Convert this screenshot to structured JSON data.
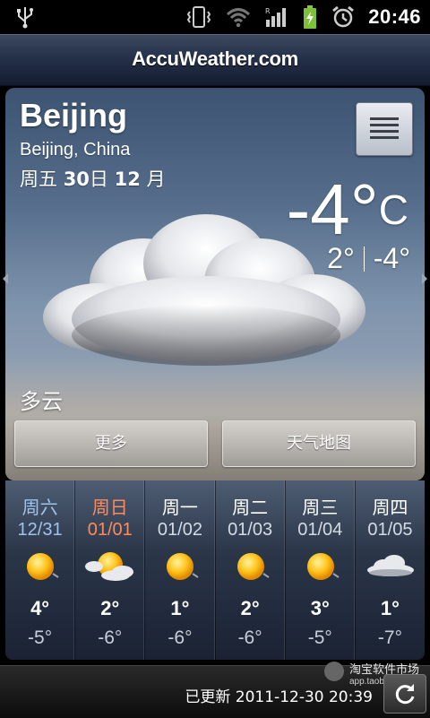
{
  "status_bar": {
    "time": "20:46"
  },
  "header": {
    "brand": "AccuWeather.com"
  },
  "location": {
    "city": "Beijing",
    "region": "Beijing, China"
  },
  "date": {
    "weekday": "周五",
    "day": "30",
    "day_suffix": "日",
    "month": "12",
    "month_suffix": "月"
  },
  "current": {
    "temp": "-4°",
    "unit": "C",
    "high": "2°",
    "low": "-4°",
    "condition": "多云"
  },
  "buttons": {
    "more": "更多",
    "map": "天气地图"
  },
  "forecast": [
    {
      "day": "周六",
      "date": "12/31",
      "high": "4°",
      "low": "-5°",
      "icon": "sunny-icon",
      "color": "#9fc3ee"
    },
    {
      "day": "周日",
      "date": "01/01",
      "high": "2°",
      "low": "-6°",
      "icon": "partly-cloudy-icon",
      "color": "#ff8a5c"
    },
    {
      "day": "周一",
      "date": "01/02",
      "high": "1°",
      "low": "-6°",
      "icon": "sunny-icon",
      "color": "#ffffff"
    },
    {
      "day": "周二",
      "date": "01/03",
      "high": "2°",
      "low": "-6°",
      "icon": "sunny-icon",
      "color": "#ffffff"
    },
    {
      "day": "周三",
      "date": "01/04",
      "high": "3°",
      "low": "-5°",
      "icon": "sunny-icon",
      "color": "#ffffff"
    },
    {
      "day": "周四",
      "date": "01/05",
      "high": "1°",
      "low": "-7°",
      "icon": "cloudy-icon",
      "color": "#ffffff"
    }
  ],
  "footer": {
    "updated": "已更新 2011-12-30 20:39"
  },
  "watermark": {
    "line1": "淘宝软件市场",
    "line2": "app.taobao.com"
  }
}
